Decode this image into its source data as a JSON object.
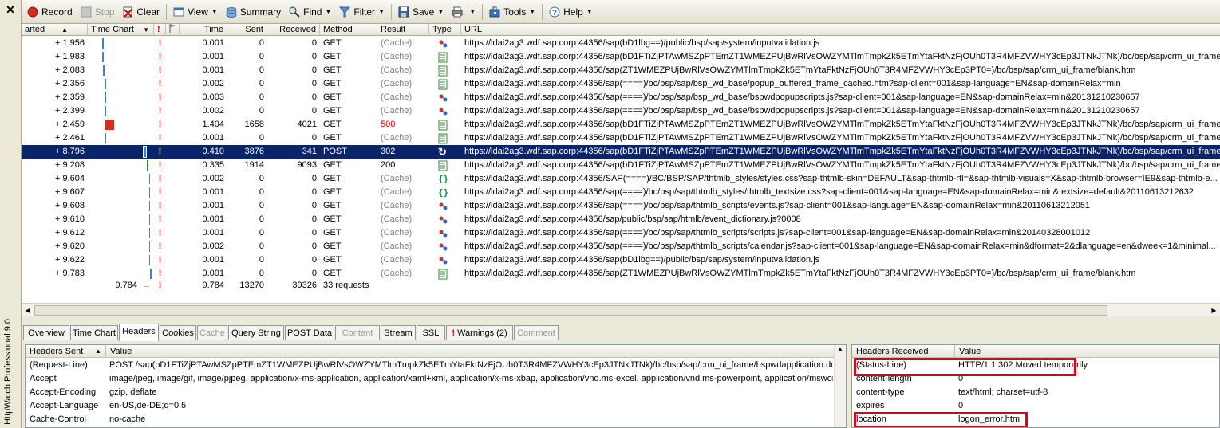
{
  "app": {
    "close_glyph": "✕",
    "title_vertical": "HttpWatch Professional 9.0"
  },
  "toolbar": {
    "record": "Record",
    "stop": "Stop",
    "clear": "Clear",
    "view": "View",
    "summary": "Summary",
    "find": "Find",
    "filter": "Filter",
    "save": "Save",
    "tools": "Tools",
    "help": "Help"
  },
  "grid": {
    "columns": [
      "arted",
      "Time Chart",
      "!",
      "",
      "Time",
      "Sent",
      "Received",
      "Method",
      "Result",
      "Type",
      "URL"
    ],
    "rows": [
      {
        "started": "+ 1.956",
        "time": "0.001",
        "sent": "0",
        "received": "0",
        "method": "GET",
        "result": "(Cache)",
        "type": "link",
        "url": "https://ldai2ag3.wdf.sap.corp:44356/sap(bD1lbg==)/public/bsp/sap/system/inputvalidation.js"
      },
      {
        "started": "+ 1.983",
        "time": "0.001",
        "sent": "0",
        "received": "0",
        "method": "GET",
        "result": "(Cache)",
        "type": "page",
        "url": "https://ldai2ag3.wdf.sap.corp:44356/sap(bD1FTiZjPTAwMSZpPTEmZT1WMEZPUjBwRlVsOWZYMTlmTmpkZk5ETmYtaFktNzFjOUh0T3R4MFZVWHY3cEp3JTNkJTNk)/bc/bsp/sap/crm_ui_frame/blank.htm"
      },
      {
        "started": "+ 2.083",
        "time": "0.001",
        "sent": "0",
        "received": "0",
        "method": "GET",
        "result": "(Cache)",
        "type": "page",
        "url": "https://ldai2ag3.wdf.sap.corp:44356/sap(ZT1WMEZPUjBwRlVsOWZYMTlmTmpkZk5ETmYtaFktNzFjOUh0T3R4MFZVWHY3cEp3PT0=)/bc/bsp/sap/crm_ui_frame/blank.htm"
      },
      {
        "started": "+ 2.356",
        "time": "0.002",
        "sent": "0",
        "received": "0",
        "method": "GET",
        "result": "(Cache)",
        "type": "page",
        "url": "https://ldai2ag3.wdf.sap.corp:44356/sap(====)/bc/bsp/sap/bsp_wd_base/popup_buffered_frame_cached.htm?sap-client=001&sap-language=EN&sap-domainRelax=min"
      },
      {
        "started": "+ 2.359",
        "time": "0.003",
        "sent": "0",
        "received": "0",
        "method": "GET",
        "result": "(Cache)",
        "type": "link",
        "url": "https://ldai2ag3.wdf.sap.corp:44356/sap(====)/bc/bsp/sap/bsp_wd_base/bspwdpopupscripts.js?sap-client=001&sap-language=EN&sap-domainRelax=min&20131210230657"
      },
      {
        "started": "+ 2.399",
        "time": "0.002",
        "sent": "0",
        "received": "0",
        "method": "GET",
        "result": "(Cache)",
        "type": "link",
        "url": "https://ldai2ag3.wdf.sap.corp:44356/sap(====)/bc/bsp/sap/bsp_wd_base/bspwdpopupscripts.js?sap-client=001&sap-language=EN&sap-domainRelax=min&20131210230657"
      },
      {
        "started": "+ 2.459",
        "time": "1.404",
        "sent": "1658",
        "received": "4021",
        "method": "GET",
        "result": "500",
        "type": "page",
        "url": "https://ldai2ag3.wdf.sap.corp:44356/sap(bD1FTiZjPTAwMSZpPTEmZT1WMEZPUjBwRlVsOWZYMTlmTmpkZk5ETmYtaFktNzFjOUh0T3R4MFZVWHY3cEp3JTNkJTNk)/bc/bsp/sap/crm_ui_frame/bspwda..."
      },
      {
        "started": "+ 2.461",
        "time": "0.001",
        "sent": "0",
        "received": "0",
        "method": "GET",
        "result": "(Cache)",
        "type": "page",
        "url": "https://ldai2ag3.wdf.sap.corp:44356/sap(bD1FTiZjPTAwMSZpPTEmZT1WMEZPUjBwRlVsOWZYMTlmTmpkZk5ETmYtaFktNzFjOUh0T3R4MFZVWHY3cEp3JTNkJTNk)/bc/bsp/sap/crm_ui_frame/blank.htm"
      },
      {
        "started": "+ 8.796",
        "time": "0.410",
        "sent": "3876",
        "received": "341",
        "method": "POST",
        "result": "302",
        "type": "redirect",
        "url": "https://ldai2ag3.wdf.sap.corp:44356/sap(bD1FTiZjPTAwMSZpPTEmZT1WMEZPUjBwRlVsOWZYMTlmTmpkZk5ETmYtaFktNzFjOUh0T3R4MFZVWHY3cEp3JTNkJTNk)/bc/bsp/sap/crm_ui_frame/bspwda..."
      },
      {
        "started": "+ 9.208",
        "time": "0.335",
        "sent": "1914",
        "received": "9093",
        "method": "GET",
        "result": "200",
        "type": "page",
        "url": "https://ldai2ag3.wdf.sap.corp:44356/sap(bD1FTiZjPTAwMSZpPTEmZT1WMEZPUjBwRlVsOWZYMTlmTmpkZk5ETmYtaFktNzFjOUh0T3R4MFZVWHY3cEp3JTNkJTNk)/bc/bsp/sap/crm_ui_frame/logon_e..."
      },
      {
        "started": "+ 9.604",
        "time": "0.002",
        "sent": "0",
        "received": "0",
        "method": "GET",
        "result": "(Cache)",
        "type": "css",
        "url": "https://ldai2ag3.wdf.sap.corp:44356/SAP(====)/BC/BSP/SAP/thtmlb_styles/styles.css?sap-thtmlb-skin=DEFAULT&sap-thtmlb-rtl=&sap-thtmlb-visuals=X&sap-thtmlb-browser=IE9&sap-thtmlb-e..."
      },
      {
        "started": "+ 9.607",
        "time": "0.001",
        "sent": "0",
        "received": "0",
        "method": "GET",
        "result": "(Cache)",
        "type": "css",
        "url": "https://ldai2ag3.wdf.sap.corp:44356/sap(====)/bc/bsp/sap/thtmlb_styles/thtmlb_textsize.css?sap-client=001&sap-language=EN&sap-domainRelax=min&textsize=default&20110613212632"
      },
      {
        "started": "+ 9.608",
        "time": "0.001",
        "sent": "0",
        "received": "0",
        "method": "GET",
        "result": "(Cache)",
        "type": "link",
        "url": "https://ldai2ag3.wdf.sap.corp:44356/sap(====)/bc/bsp/sap/thtmlb_scripts/events.js?sap-client=001&sap-language=EN&sap-domainRelax=min&20110613212051"
      },
      {
        "started": "+ 9.610",
        "time": "0.001",
        "sent": "0",
        "received": "0",
        "method": "GET",
        "result": "(Cache)",
        "type": "link",
        "url": "https://ldai2ag3.wdf.sap.corp:44356/sap/public/bsp/sap/htmlb/event_dictionary.js?0008"
      },
      {
        "started": "+ 9.612",
        "time": "0.001",
        "sent": "0",
        "received": "0",
        "method": "GET",
        "result": "(Cache)",
        "type": "link",
        "url": "https://ldai2ag3.wdf.sap.corp:44356/sap(====)/bc/bsp/sap/thtmlb_scripts/scripts.js?sap-client=001&sap-language=EN&sap-domainRelax=min&20140328001012"
      },
      {
        "started": "+ 9.620",
        "time": "0.002",
        "sent": "0",
        "received": "0",
        "method": "GET",
        "result": "(Cache)",
        "type": "link",
        "url": "https://ldai2ag3.wdf.sap.corp:44356/sap(====)/bc/bsp/sap/thtmlb_scripts/calendar.js?sap-client=001&sap-language=EN&sap-domainRelax=min&dformat=2&dlanguage=en&dweek=1&minimal..."
      },
      {
        "started": "+ 9.622",
        "time": "0.001",
        "sent": "0",
        "received": "0",
        "method": "GET",
        "result": "(Cache)",
        "type": "link",
        "url": "https://ldai2ag3.wdf.sap.corp:44356/sap(bD1lbg==)/public/bsp/sap/system/inputvalidation.js"
      },
      {
        "started": "+ 9.783",
        "time": "0.001",
        "sent": "0",
        "received": "0",
        "method": "GET",
        "result": "(Cache)",
        "type": "page",
        "url": "https://ldai2ag3.wdf.sap.corp:44356/sap(ZT1WMEZPUjBwRlVsOWZYMTlmTmpkZk5ETmYtaFktNzFjOUh0T3R4MFZVWHY3cEp3PT0=)/bc/bsp/sap/crm_ui_frame/blank.htm"
      }
    ],
    "selected_index": 8,
    "summary": {
      "chart": "9.784",
      "arrow": "→",
      "excl": "!",
      "time": "9.784",
      "sent": "13270",
      "received": "39326",
      "requests": "33 requests"
    }
  },
  "tabs": [
    "Overview",
    "Time Chart",
    "Headers",
    "Cookies",
    "Cache",
    "Query String",
    "POST Data",
    "Content",
    "Stream",
    "SSL",
    "Warnings (2)",
    "Comment"
  ],
  "active_tab": "Headers",
  "headers_sent": {
    "col_name": "Headers Sent",
    "col_value": "Value",
    "rows": [
      {
        "name": "(Request-Line)",
        "value": "POST /sap(bD1FTiZjPTAwMSZpPTEmZT1WMEZPUjBwRlVsOWZYMTlmTmpkZk5ETmYtaFktNzFjOUh0T3R4MFZVWHY3cEp3JTNkJTNk)/bc/bsp/sap/crm_ui_frame/bspwdapplication.do?id=3&wcf-r"
      },
      {
        "name": "Accept",
        "value": "image/jpeg, image/gif, image/pjpeg, application/x-ms-application, application/xaml+xml, application/x-ms-xbap, application/vnd.ms-excel, application/vnd.ms-powerpoint, application/msword"
      },
      {
        "name": "Accept-Encoding",
        "value": "gzip, deflate"
      },
      {
        "name": "Accept-Language",
        "value": "en-US,de-DE;q=0.5"
      },
      {
        "name": "Cache-Control",
        "value": "no-cache"
      }
    ]
  },
  "headers_received": {
    "col_name": "Headers Received",
    "col_value": "Value",
    "rows": [
      {
        "name": "(Status-Line)",
        "value": "HTTP/1.1 302 Moved temporarily"
      },
      {
        "name": "content-length",
        "value": "0"
      },
      {
        "name": "content-type",
        "value": "text/html; charset=utf-8"
      },
      {
        "name": "expires",
        "value": "0"
      },
      {
        "name": "location",
        "value": "logon_error.htm"
      }
    ]
  },
  "colors": {
    "selection": "#0a246a",
    "highlight": "#e3001b",
    "bar_blue": "#4a7fc1",
    "bar_red": "#d03020",
    "bar_green": "#2e8b2e"
  }
}
